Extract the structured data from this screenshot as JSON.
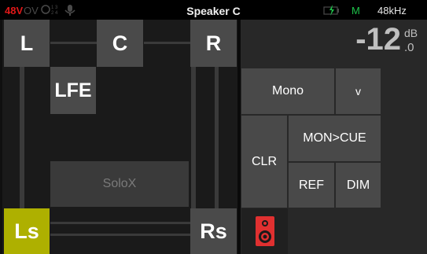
{
  "status": {
    "phantom": "48V",
    "ov": "OV",
    "title": "Speaker C",
    "mode": "M",
    "sample_rate": "48kHz"
  },
  "speakers": {
    "L": "L",
    "C": "C",
    "R": "R",
    "LFE": "LFE",
    "Ls": "Ls",
    "Rs": "Rs"
  },
  "solox": "SoloX",
  "volume": {
    "value": "-12",
    "unit": "dB",
    "decimal": ".0"
  },
  "buttons": {
    "mono": "Mono",
    "dropdown": "v",
    "clr": "CLR",
    "mon_cue": "MON>CUE",
    "ref": "REF",
    "dim": "DIM"
  },
  "colors": {
    "selected_speaker": "#aeb000",
    "speaker_icon": "#e03030",
    "phantom": "#e01818",
    "mode": "#1ec24a"
  },
  "icons": [
    "grid-icon",
    "microphone-icon",
    "battery-charging-icon",
    "speaker-icon"
  ]
}
